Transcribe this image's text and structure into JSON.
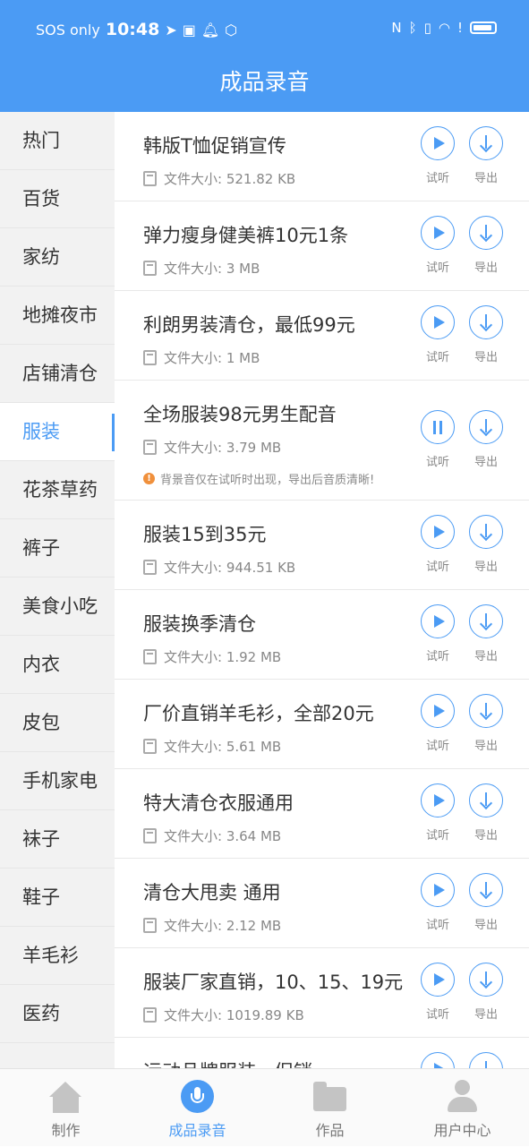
{
  "status_bar": {
    "carrier": "SOS only",
    "time": "10:48",
    "right_icons": [
      "nfc-icon",
      "bluetooth-icon",
      "vibrate-icon",
      "wifi-icon",
      "alert-icon",
      "battery-icon"
    ]
  },
  "header": {
    "title": "成品录音"
  },
  "sidebar": {
    "items": [
      {
        "label": "热门"
      },
      {
        "label": "百货"
      },
      {
        "label": "家纺"
      },
      {
        "label": "地摊夜市"
      },
      {
        "label": "店铺清仓"
      },
      {
        "label": "服装",
        "active": true
      },
      {
        "label": "花茶草药"
      },
      {
        "label": "裤子"
      },
      {
        "label": "美食小吃"
      },
      {
        "label": "内衣"
      },
      {
        "label": "皮包"
      },
      {
        "label": "手机家电"
      },
      {
        "label": "袜子"
      },
      {
        "label": "鞋子"
      },
      {
        "label": "羊毛衫"
      },
      {
        "label": "医药"
      }
    ]
  },
  "list": {
    "play_label": "试听",
    "export_label": "导出",
    "items": [
      {
        "title": "韩版T恤促销宣传",
        "size": "文件大小: 521.82 KB"
      },
      {
        "title": "弹力瘦身健美裤10元1条",
        "size": "文件大小: 3 MB"
      },
      {
        "title": "利朗男装清仓，最低99元",
        "size": "文件大小: 1 MB"
      },
      {
        "title": "全场服装98元男生配音",
        "size": "文件大小: 3.79 MB",
        "playing": true,
        "notice": "背景音仅在试听时出现，导出后音质清晰!"
      },
      {
        "title": "服装15到35元",
        "size": "文件大小: 944.51 KB"
      },
      {
        "title": "服装换季清仓",
        "size": "文件大小: 1.92 MB"
      },
      {
        "title": "厂价直销羊毛衫，全部20元",
        "size": "文件大小: 5.61 MB"
      },
      {
        "title": "特大清仓衣服通用",
        "size": "文件大小: 3.64 MB"
      },
      {
        "title": "清仓大甩卖 通用",
        "size": "文件大小: 2.12 MB"
      },
      {
        "title": "服装厂家直销，10、15、19元",
        "size": "文件大小: 1019.89 KB"
      },
      {
        "title": "运动品牌服装，促销",
        "size": ""
      }
    ]
  },
  "bottom_nav": {
    "items": [
      {
        "label": "制作",
        "icon": "home-icon"
      },
      {
        "label": "成品录音",
        "icon": "microphone-icon",
        "active": true
      },
      {
        "label": "作品",
        "icon": "folder-icon"
      },
      {
        "label": "用户中心",
        "icon": "user-icon"
      }
    ]
  },
  "colors": {
    "accent": "#4b9bf4",
    "warning": "#f0903c"
  }
}
